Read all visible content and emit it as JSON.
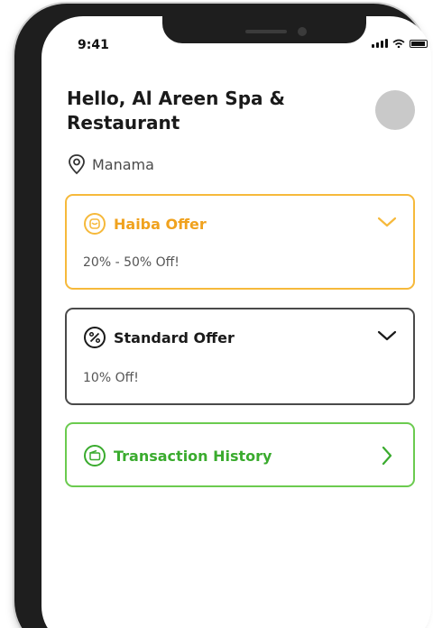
{
  "status_bar": {
    "time": "9:41"
  },
  "header": {
    "greeting": "Hello, Al Areen Spa & Restaurant",
    "avatar_icon": "avatar-placeholder"
  },
  "location": {
    "icon": "location-pin-icon",
    "label": "Manama"
  },
  "offers": {
    "haiba": {
      "title": "Haiba Offer",
      "detail": "20% - 50% Off!",
      "icon": "haiba-logo-icon",
      "color": "#f0a21e"
    },
    "standard": {
      "title": "Standard Offer",
      "detail": "10% Off!",
      "icon": "percent-icon",
      "color": "#1a1a1a"
    }
  },
  "transaction_history": {
    "label": "Transaction History",
    "icon": "wallet-icon",
    "color": "#3aab2e"
  }
}
